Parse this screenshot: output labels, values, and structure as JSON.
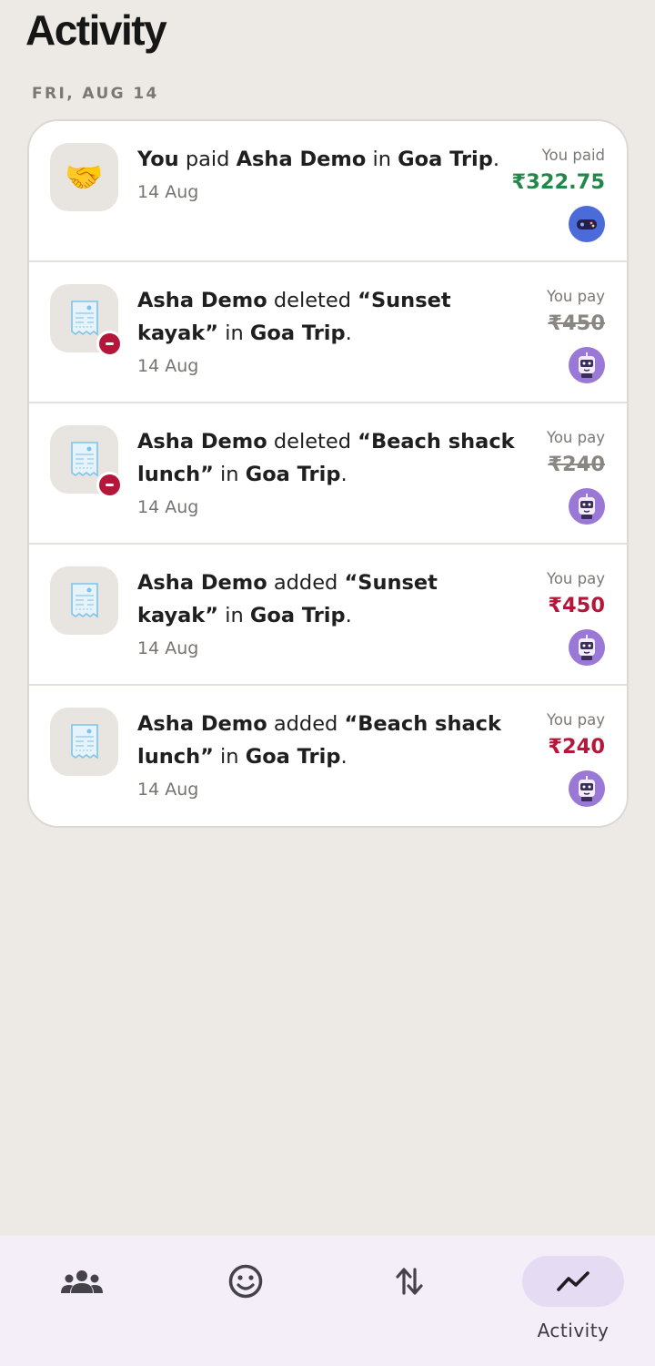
{
  "page": {
    "title": "Activity"
  },
  "date_header": "FRI, AUG 14",
  "colors": {
    "positive": "#23874a",
    "negative": "#b5173a",
    "background": "#ede9e5",
    "nav_active": "#e5dcf4"
  },
  "activities": [
    {
      "icon": "handshake-icon",
      "icon_glyph": "🤝",
      "parts": [
        {
          "text": "You",
          "bold": true
        },
        {
          "text": " paid ",
          "bold": false
        },
        {
          "text": "Asha Demo",
          "bold": true
        },
        {
          "text": " in ",
          "bold": false
        },
        {
          "text": "Goa Trip",
          "bold": true
        },
        {
          "text": ".",
          "bold": false
        }
      ],
      "date": "14 Aug",
      "amount_label": "You paid",
      "amount": "₹322.75",
      "amount_style": "positive",
      "deleted": false,
      "avatar": "blue"
    },
    {
      "icon": "receipt-icon",
      "parts": [
        {
          "text": "Asha Demo",
          "bold": true
        },
        {
          "text": " deleted ",
          "bold": false
        },
        {
          "text": "“Sunset kayak”",
          "bold": true
        },
        {
          "text": " in ",
          "bold": false
        },
        {
          "text": "Goa Trip",
          "bold": true
        },
        {
          "text": ".",
          "bold": false
        }
      ],
      "date": "14 Aug",
      "amount_label": "You pay",
      "amount": "₹450",
      "amount_style": "struck",
      "deleted": true,
      "avatar": "purple"
    },
    {
      "icon": "receipt-icon",
      "parts": [
        {
          "text": "Asha Demo",
          "bold": true
        },
        {
          "text": " deleted ",
          "bold": false
        },
        {
          "text": "“Beach shack lunch”",
          "bold": true
        },
        {
          "text": " in ",
          "bold": false
        },
        {
          "text": "Goa Trip",
          "bold": true
        },
        {
          "text": ".",
          "bold": false
        }
      ],
      "date": "14 Aug",
      "amount_label": "You pay",
      "amount": "₹240",
      "amount_style": "struck",
      "deleted": true,
      "avatar": "purple"
    },
    {
      "icon": "receipt-icon",
      "parts": [
        {
          "text": "Asha Demo",
          "bold": true
        },
        {
          "text": " added ",
          "bold": false
        },
        {
          "text": "“Sunset kayak”",
          "bold": true
        },
        {
          "text": " in ",
          "bold": false
        },
        {
          "text": "Goa Trip",
          "bold": true
        },
        {
          "text": ".",
          "bold": false
        }
      ],
      "date": "14 Aug",
      "amount_label": "You pay",
      "amount": "₹450",
      "amount_style": "negative",
      "deleted": false,
      "avatar": "purple"
    },
    {
      "icon": "receipt-icon",
      "parts": [
        {
          "text": "Asha Demo",
          "bold": true
        },
        {
          "text": " added ",
          "bold": false
        },
        {
          "text": "“Beach shack lunch”",
          "bold": true
        },
        {
          "text": " in ",
          "bold": false
        },
        {
          "text": "Goa Trip",
          "bold": true
        },
        {
          "text": ".",
          "bold": false
        }
      ],
      "date": "14 Aug",
      "amount_label": "You pay",
      "amount": "₹240",
      "amount_style": "negative",
      "deleted": false,
      "avatar": "purple"
    }
  ],
  "nav": {
    "items": [
      {
        "icon": "groups-icon",
        "label": ""
      },
      {
        "icon": "friends-icon",
        "label": ""
      },
      {
        "icon": "transfers-icon",
        "label": ""
      },
      {
        "icon": "activity-icon",
        "label": "Activity",
        "active": true
      }
    ]
  }
}
